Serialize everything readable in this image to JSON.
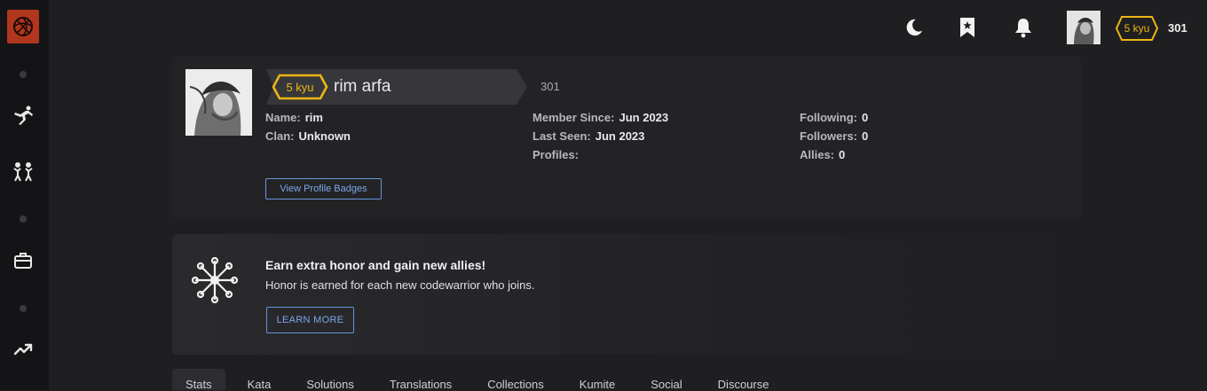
{
  "topbar": {
    "rank": "5 kyu",
    "honor": "301",
    "icons": [
      "moon-icon",
      "bookmark-icon",
      "bell-icon"
    ]
  },
  "sidebar": {
    "icons": [
      "logo-icon",
      "training-icon",
      "practice-icon",
      "work-icon",
      "leaderboards-icon"
    ]
  },
  "profile": {
    "rank": "5 kyu",
    "username": "rim arfa",
    "honor": "301",
    "name_label": "Name:",
    "name_value": "rim",
    "clan_label": "Clan:",
    "clan_value": "Unknown",
    "member_since_label": "Member Since:",
    "member_since_value": "Jun 2023",
    "last_seen_label": "Last Seen:",
    "last_seen_value": "Jun 2023",
    "profiles_label": "Profiles:",
    "following_label": "Following:",
    "following_value": "0",
    "followers_label": "Followers:",
    "followers_value": "0",
    "allies_label": "Allies:",
    "allies_value": "0",
    "badges_button": "View Profile Badges"
  },
  "promo": {
    "title": "Earn extra honor and gain new allies!",
    "subtitle": "Honor is earned for each new codewarrior who joins.",
    "button": "LEARN MORE"
  },
  "tabs": [
    {
      "label": "Stats",
      "active": true
    },
    {
      "label": "Kata"
    },
    {
      "label": "Solutions"
    },
    {
      "label": "Translations"
    },
    {
      "label": "Collections"
    },
    {
      "label": "Kumite"
    },
    {
      "label": "Social"
    },
    {
      "label": "Discourse"
    }
  ],
  "colors": {
    "background": "#1f1f22",
    "sidebar": "#141416",
    "card": "#232326",
    "rank_yellow": "#ecb613",
    "link_blue": "#6795de",
    "logo_red": "#b1361e"
  }
}
